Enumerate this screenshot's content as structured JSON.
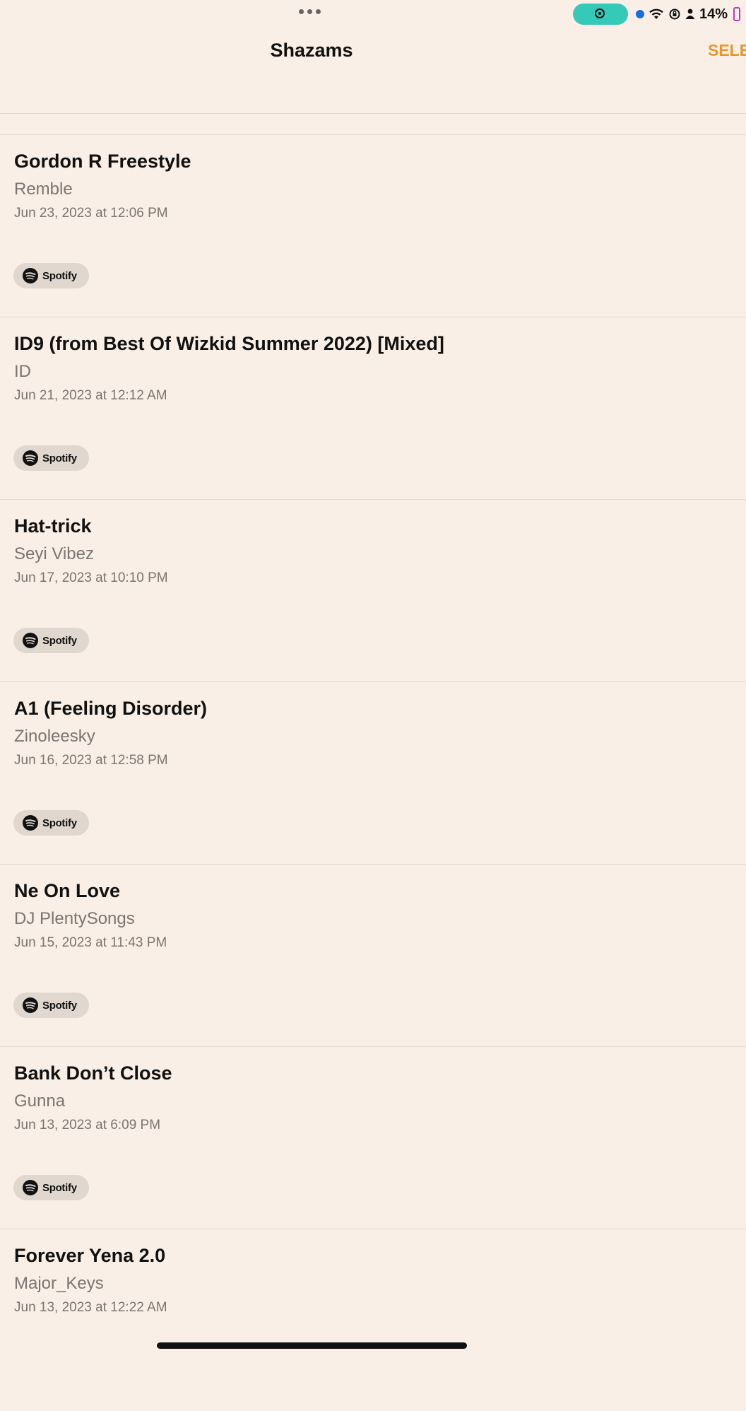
{
  "status_bar": {
    "battery_percent": "14%",
    "icons": [
      "more-dots-icon",
      "screen-record-icon",
      "blue-dot-icon",
      "wifi-icon",
      "rotation-lock-icon",
      "person-icon",
      "battery-icon"
    ],
    "colors": {
      "record_pill": "#35c9b8",
      "dot": "#1a6ce0",
      "battery": "#c23ab8"
    }
  },
  "header": {
    "title": "Shazams",
    "select_label": "SELE"
  },
  "items": [
    {
      "title": "Gordon R Freestyle",
      "artist": "Remble",
      "date": "Jun 23, 2023 at 12:06 PM",
      "badge": "Spotify"
    },
    {
      "title": "ID9 (from Best Of Wizkid Summer 2022) [Mixed]",
      "artist": "ID",
      "date": "Jun 21, 2023 at 12:12 AM",
      "badge": "Spotify"
    },
    {
      "title": "Hat-trick",
      "artist": "Seyi Vibez",
      "date": "Jun 17, 2023 at 10:10 PM",
      "badge": "Spotify"
    },
    {
      "title": "A1 (Feeling Disorder)",
      "artist": "Zinoleesky",
      "date": "Jun 16, 2023 at 12:58 PM",
      "badge": "Spotify"
    },
    {
      "title": "Ne On Love",
      "artist": "DJ PlentySongs",
      "date": "Jun 15, 2023 at 11:43 PM",
      "badge": "Spotify"
    },
    {
      "title": "Bank Don’t Close",
      "artist": "Gunna",
      "date": "Jun 13, 2023 at 6:09 PM",
      "badge": "Spotify"
    },
    {
      "title": "Forever Yena 2.0",
      "artist": "Major_Keys",
      "date": "Jun 13, 2023 at 12:22 AM",
      "badge": ""
    }
  ],
  "colors": {
    "background": "#f9efe6",
    "accent": "#e8962e",
    "secondary_text": "#7a7570",
    "badge_bg": "#e0d8cf"
  }
}
